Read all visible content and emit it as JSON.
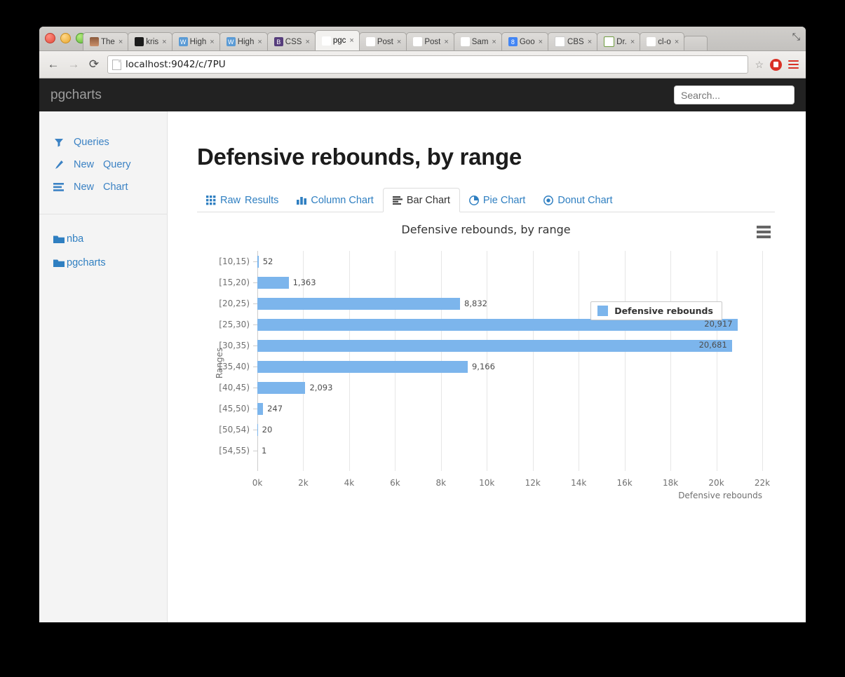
{
  "browser": {
    "tabs": [
      {
        "title": "The",
        "icon": "photo-favicon",
        "glyph": "",
        "cls": "fav-photo",
        "active": false
      },
      {
        "title": "kris",
        "icon": "github-favicon",
        "glyph": "",
        "cls": "fav-gh",
        "active": false
      },
      {
        "title": "High",
        "icon": "highcharts-favicon",
        "glyph": "W",
        "cls": "fav-w",
        "active": false
      },
      {
        "title": "High",
        "icon": "highcharts-favicon",
        "glyph": "W",
        "cls": "fav-w",
        "active": false
      },
      {
        "title": "CSS",
        "icon": "bootstrap-favicon",
        "glyph": "B",
        "cls": "fav-b",
        "active": false
      },
      {
        "title": "pgc",
        "icon": "pgcharts-favicon",
        "glyph": "█",
        "cls": "fav-chart",
        "active": true
      },
      {
        "title": "Post",
        "icon": "postgres-favicon",
        "glyph": "☸",
        "cls": "fav-pg",
        "active": false
      },
      {
        "title": "Post",
        "icon": "postgres-owl-favicon",
        "glyph": "☻",
        "cls": "fav-owl",
        "active": false
      },
      {
        "title": "Sam",
        "icon": "snowflake-favicon",
        "glyph": "❄",
        "cls": "fav-snow",
        "active": false
      },
      {
        "title": "Goo",
        "icon": "google-favicon",
        "glyph": "8",
        "cls": "fav-g",
        "active": false
      },
      {
        "title": "CBS",
        "icon": "document-favicon",
        "glyph": "",
        "cls": "fav-doc",
        "active": false
      },
      {
        "title": "Dr.",
        "icon": "s-favicon",
        "glyph": "S",
        "cls": "fav-s",
        "active": false
      },
      {
        "title": "cl-o",
        "icon": "lambda-favicon",
        "glyph": "Λ",
        "cls": "fav-a",
        "active": false
      }
    ],
    "close_label": "×",
    "back_label": "←",
    "forward_label": "→",
    "reload_label": "⟳",
    "url": "localhost:9042/c/7PU",
    "star_label": "☆",
    "expand_label": "⤡"
  },
  "app": {
    "brand": "pgcharts",
    "search": {
      "value": "",
      "placeholder": "Search..."
    }
  },
  "sidebar": {
    "items": [
      {
        "label_primary": "Queries",
        "label_secondary": "",
        "icon": "filter-icon",
        "glyph": "▼"
      },
      {
        "label_primary": "New",
        "label_secondary": "Query",
        "icon": "pencil-icon",
        "glyph": "✎"
      },
      {
        "label_primary": "New",
        "label_secondary": "Chart",
        "icon": "list-icon",
        "glyph": "☰"
      }
    ],
    "folders": [
      {
        "label": "nba",
        "icon": "folder-icon",
        "glyph": "📁"
      },
      {
        "label": "pgcharts",
        "icon": "folder-icon",
        "glyph": "📁"
      }
    ]
  },
  "main": {
    "page_title": "Defensive rebounds, by range",
    "tabs": [
      {
        "label": "Raw",
        "label2": "Results",
        "icon": "grid-icon",
        "glyph": "☸",
        "active": false
      },
      {
        "label": "Column Chart",
        "label2": "",
        "icon": "column-chart-icon",
        "glyph": "█",
        "active": false
      },
      {
        "label": "Bar Chart",
        "label2": "",
        "icon": "bar-chart-icon",
        "glyph": "☰",
        "active": true
      },
      {
        "label": "Pie Chart",
        "label2": "",
        "icon": "pie-chart-icon",
        "glyph": "◔",
        "active": false
      },
      {
        "label": "Donut Chart",
        "label2": "",
        "icon": "donut-chart-icon",
        "glyph": "◉",
        "active": false
      }
    ]
  },
  "chart_data": {
    "type": "bar",
    "title": "Defensive rebounds, by range",
    "xlabel": "Defensive rebounds",
    "ylabel": "Ranges",
    "categories": [
      "[10,15)",
      "[15,20)",
      "[20,25)",
      "[25,30)",
      "[30,35)",
      "[35,40)",
      "[40,45)",
      "[45,50)",
      "[50,54)",
      "[54,55)"
    ],
    "values": [
      52,
      1363,
      8832,
      20917,
      20681,
      9166,
      2093,
      247,
      20,
      1
    ],
    "value_labels": [
      "52",
      "1,363",
      "8,832",
      "20,917",
      "20,681",
      "9,166",
      "2,093",
      "247",
      "20",
      "1"
    ],
    "xlim": [
      0,
      22000
    ],
    "xticks": [
      0,
      2000,
      4000,
      6000,
      8000,
      10000,
      12000,
      14000,
      16000,
      18000,
      20000,
      22000
    ],
    "xtick_labels": [
      "0k",
      "2k",
      "4k",
      "6k",
      "8k",
      "10k",
      "12k",
      "14k",
      "16k",
      "18k",
      "20k",
      "22k"
    ],
    "series": [
      {
        "name": "Defensive rebounds",
        "color": "#7cb5ec"
      }
    ],
    "legend": {
      "label": "Defensive rebounds",
      "position": "inside-right"
    },
    "grid": true,
    "menu_label": "chart-context-menu"
  },
  "colors": {
    "bar": "#7cb5ec",
    "link": "#2f7fc1",
    "header_bg": "#222222",
    "sidebar_bg": "#f4f4f4"
  }
}
